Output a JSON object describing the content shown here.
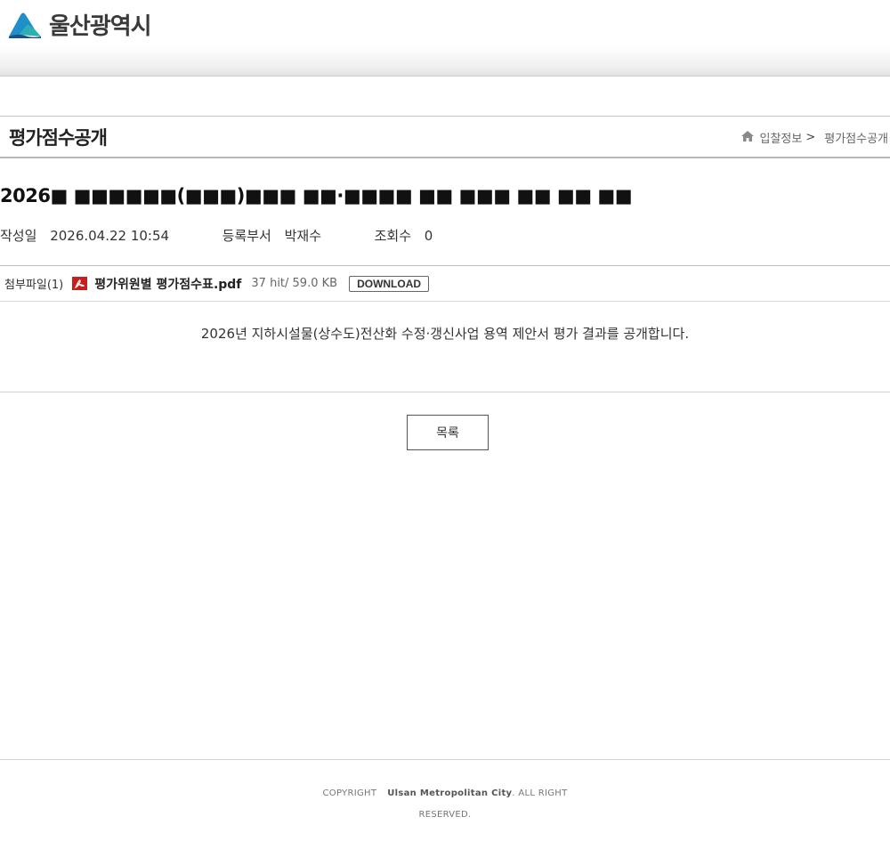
{
  "header": {
    "logo_text": "울산광역시",
    "colors": {
      "logo_blue": "#1e8fc8",
      "logo_teal": "#2ab0b0",
      "logo_dark": "#1a4f8a"
    }
  },
  "title_bar": {
    "page_title": "평가점수공개",
    "breadcrumb": {
      "home_icon": "home-icon",
      "parent": "입찰정보",
      "separator": ">",
      "current": "평가점수공개"
    }
  },
  "post": {
    "title": "2026■ ■■■■■■(■■■)■■■ ■■·■■■■ ■■ ■■■ ■■ ■■ ■■",
    "meta": {
      "date_label": "작성일",
      "date_value": "2026.04.22 10:54",
      "dept_label": "등록부서",
      "dept_value": "박재수",
      "views_label": "조회수",
      "views_value": "0"
    },
    "attachment": {
      "label": "첨부파일(1)",
      "icon": "pdf-icon",
      "file_name": "평가위원별 평가점수표.pdf",
      "file_info": "37 hit/ 59.0 KB",
      "download_label": "DOWNLOAD"
    },
    "body": "2026년 지하시설물(상수도)전산화 수정·갱신사업 용역 제안서 평가 결과를 공개합니다."
  },
  "actions": {
    "list_label": "목록"
  },
  "footer": {
    "copyright": "COPYRIGHT",
    "org": "Ulsan Metropolitan City",
    "rights": ". ALL RIGHT RESERVED."
  }
}
